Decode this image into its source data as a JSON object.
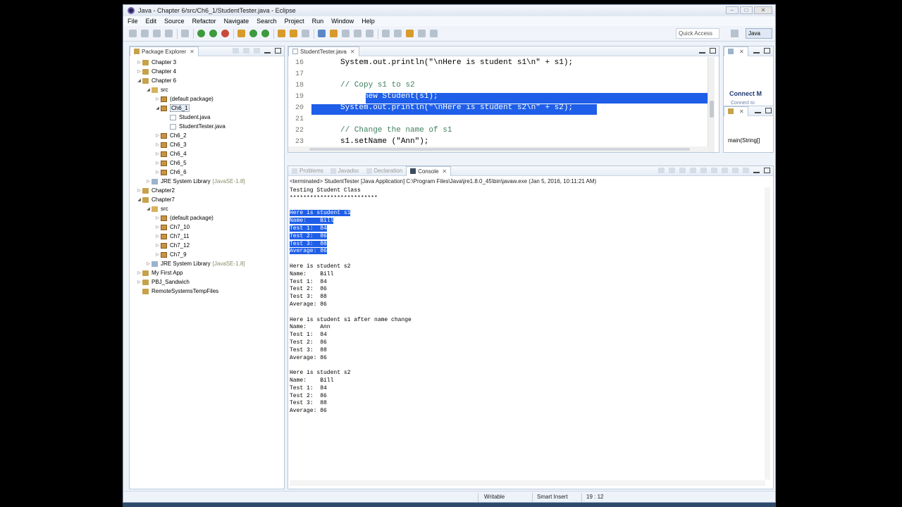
{
  "window": {
    "title": "Java - Chapter 6/src/Ch6_1/StudentTester.java - Eclipse"
  },
  "menu": [
    "File",
    "Edit",
    "Source",
    "Refactor",
    "Navigate",
    "Search",
    "Project",
    "Run",
    "Window",
    "Help"
  ],
  "toolbar": {
    "quick_access": "Quick Access",
    "perspective": "Java"
  },
  "package_explorer": {
    "tab_label": "Package Explorer",
    "nodes": [
      {
        "label": "Chapter 3",
        "expanded": false
      },
      {
        "label": "Chapter 4",
        "expanded": false
      },
      {
        "label": "Chapter 6",
        "expanded": true
      },
      {
        "label": "src",
        "expanded": true
      },
      {
        "label": "(default package)",
        "expanded": false
      },
      {
        "label": "Ch6_1",
        "expanded": true
      },
      {
        "label": "Student.java",
        "expanded": false
      },
      {
        "label": "StudentTester.java",
        "expanded": false
      },
      {
        "label": "Ch6_2",
        "expanded": false
      },
      {
        "label": "Ch6_3",
        "expanded": false
      },
      {
        "label": "Ch6_4",
        "expanded": false
      },
      {
        "label": "Ch6_5",
        "expanded": false
      },
      {
        "label": "Ch6_6",
        "expanded": false
      },
      {
        "label": "JRE System Library",
        "version": "[JavaSE-1.8]",
        "expanded": false
      },
      {
        "label": "Chapter2",
        "expanded": false
      },
      {
        "label": "Chapter7",
        "expanded": true
      },
      {
        "label": "src",
        "expanded": true
      },
      {
        "label": "(default package)",
        "expanded": false
      },
      {
        "label": "Ch7_10",
        "expanded": false
      },
      {
        "label": "Ch7_11",
        "expanded": false
      },
      {
        "label": "Ch7_12",
        "expanded": false
      },
      {
        "label": "Ch7_9",
        "expanded": false
      },
      {
        "label": "JRE System Library",
        "version": "[JavaSE-1.8]",
        "expanded": false
      },
      {
        "label": "My First App",
        "expanded": false
      },
      {
        "label": "PBJ_Sandwich",
        "expanded": false
      },
      {
        "label": "RemoteSystemsTempFiles",
        "expanded": false
      }
    ]
  },
  "editor": {
    "tab_label": "StudentTester.java",
    "lines": [
      {
        "num": "16",
        "text": "System.out.println(\"\\nHere is student s1\\n\" + s1);"
      },
      {
        "num": "17",
        "text": ""
      },
      {
        "num": "18",
        "text": "// Copy s1 to s2"
      },
      {
        "num": "19",
        "text": "s2 = new Student(s1);"
      },
      {
        "num": "20",
        "text": "System.out.println(\"\\nHere is student s2\\n\" + s2);"
      },
      {
        "num": "21",
        "text": ""
      },
      {
        "num": "22",
        "text": "// Change the name of s1"
      },
      {
        "num": "23",
        "text": "s1.setName (\"Ann\");"
      }
    ]
  },
  "outline": {
    "connect_label": "Connect M",
    "connect_sub": "Connect to",
    "main_method": "main(String[]"
  },
  "console": {
    "tabs": [
      "Problems",
      "Javadoc",
      "Declaration",
      "Console"
    ],
    "terminated": "<terminated> StudentTester [Java Application] C:\\Program Files\\Java\\jre1.8.0_45\\bin\\javaw.exe (Jan 5, 2016, 10:11:21 AM)",
    "output": [
      "Testing Student Class",
      "**************************",
      "",
      "Here is student s1",
      "Name:    Bill",
      "Test 1:  84",
      "Test 2:  86",
      "Test 3:  88",
      "Average: 86",
      "",
      "Here is student s2",
      "Name:    Bill",
      "Test 1:  84",
      "Test 2:  86",
      "Test 3:  88",
      "Average: 86",
      "",
      "Here is student s1 after name change",
      "Name:    Ann",
      "Test 1:  84",
      "Test 2:  86",
      "Test 3:  88",
      "Average: 86",
      "",
      "Here is student s2",
      "Name:    Bill",
      "Test 1:  84",
      "Test 2:  86",
      "Test 3:  88",
      "Average: 86"
    ]
  },
  "status": {
    "writable": "Writable",
    "insert_mode": "Smart Insert",
    "position": "19 : 12"
  },
  "colors": {
    "selection": "#1e5ee8",
    "comment": "#3f7f5f",
    "string": "#2a00ff",
    "keyword": "#7f0055"
  }
}
